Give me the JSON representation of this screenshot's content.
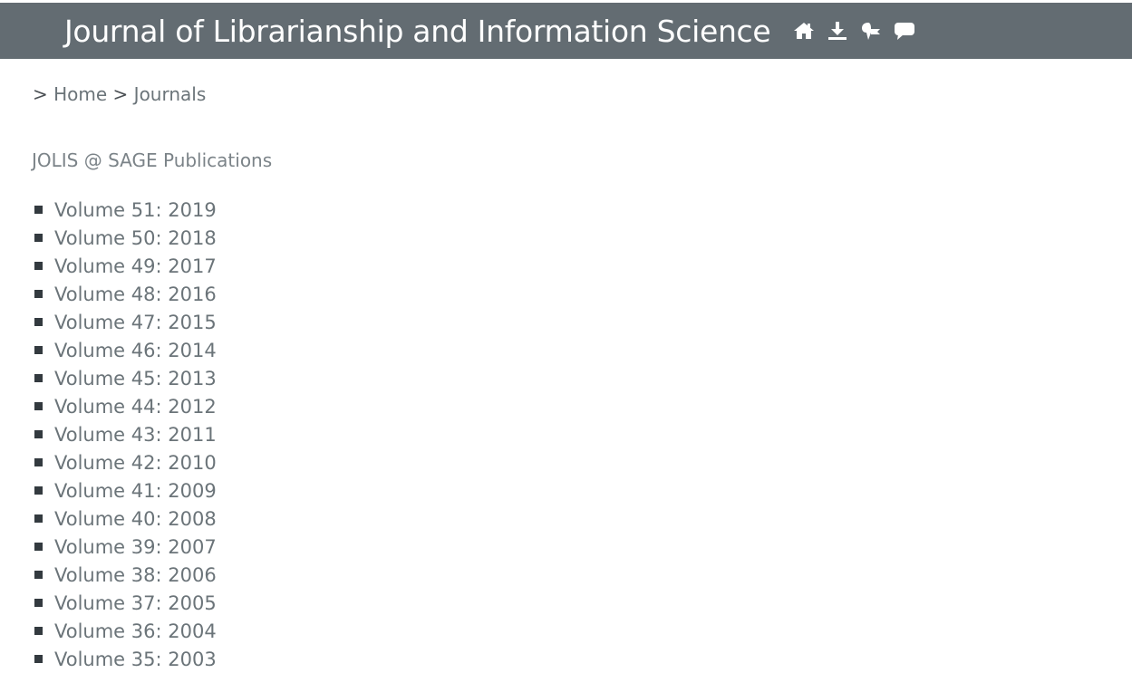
{
  "header": {
    "title": "Journal of Librarianship and Information Science",
    "background": "#636c72",
    "icons": [
      "home-icon",
      "download-icon",
      "bookmark-icon",
      "comment-icon"
    ]
  },
  "breadcrumb": {
    "sep1": ">",
    "home": "Home",
    "sep2": ">",
    "journals": "Journals"
  },
  "publisher_link": "JOLIS @ SAGE Publications",
  "volumes": [
    "Volume 51: 2019",
    "Volume 50: 2018",
    "Volume 49: 2017",
    "Volume 48: 2016",
    "Volume 47: 2015",
    "Volume 46: 2014",
    "Volume 45: 2013",
    "Volume 44: 2012",
    "Volume 43: 2011",
    "Volume 42: 2010",
    "Volume 41: 2009",
    "Volume 40: 2008",
    "Volume 39: 2007",
    "Volume 38: 2006",
    "Volume 37: 2005",
    "Volume 36: 2004",
    "Volume 35: 2003"
  ]
}
